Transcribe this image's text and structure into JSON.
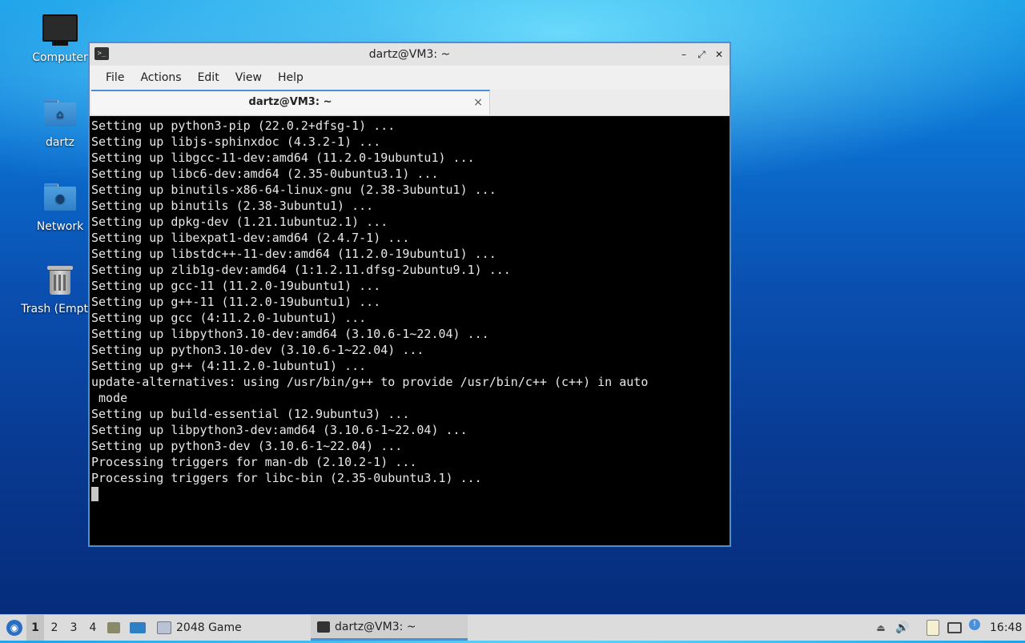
{
  "desktop": {
    "icons": [
      {
        "label": "Computer"
      },
      {
        "label": "dartz"
      },
      {
        "label": "Network"
      },
      {
        "label": "Trash (Empty)"
      }
    ]
  },
  "window": {
    "title": "dartz@VM3: ~",
    "menu": [
      "File",
      "Actions",
      "Edit",
      "View",
      "Help"
    ],
    "tab_label": "dartz@VM3: ~",
    "tab_close": "×",
    "terminal_lines": [
      "Setting up python3-pip (22.0.2+dfsg-1) ...",
      "Setting up libjs-sphinxdoc (4.3.2-1) ...",
      "Setting up libgcc-11-dev:amd64 (11.2.0-19ubuntu1) ...",
      "Setting up libc6-dev:amd64 (2.35-0ubuntu3.1) ...",
      "Setting up binutils-x86-64-linux-gnu (2.38-3ubuntu1) ...",
      "Setting up binutils (2.38-3ubuntu1) ...",
      "Setting up dpkg-dev (1.21.1ubuntu2.1) ...",
      "Setting up libexpat1-dev:amd64 (2.4.7-1) ...",
      "Setting up libstdc++-11-dev:amd64 (11.2.0-19ubuntu1) ...",
      "Setting up zlib1g-dev:amd64 (1:1.2.11.dfsg-2ubuntu9.1) ...",
      "Setting up gcc-11 (11.2.0-19ubuntu1) ...",
      "Setting up g++-11 (11.2.0-19ubuntu1) ...",
      "Setting up gcc (4:11.2.0-1ubuntu1) ...",
      "Setting up libpython3.10-dev:amd64 (3.10.6-1~22.04) ...",
      "Setting up python3.10-dev (3.10.6-1~22.04) ...",
      "Setting up g++ (4:11.2.0-1ubuntu1) ...",
      "update-alternatives: using /usr/bin/g++ to provide /usr/bin/c++ (c++) in auto",
      " mode",
      "Setting up build-essential (12.9ubuntu3) ...",
      "Setting up libpython3-dev:amd64 (3.10.6-1~22.04) ...",
      "Setting up python3-dev (3.10.6-1~22.04) ...",
      "Processing triggers for man-db (2.10.2-1) ...",
      "Processing triggers for libc-bin (2.35-0ubuntu3.1) ..."
    ]
  },
  "taskbar": {
    "workspaces": [
      "1",
      "2",
      "3",
      "4"
    ],
    "active_workspace": "1",
    "tasks": [
      {
        "label": "2048 Game"
      },
      {
        "label": "dartz@VM3: ~"
      }
    ],
    "clock": "16:48"
  },
  "colors": {
    "accent": "#4a90d9"
  }
}
